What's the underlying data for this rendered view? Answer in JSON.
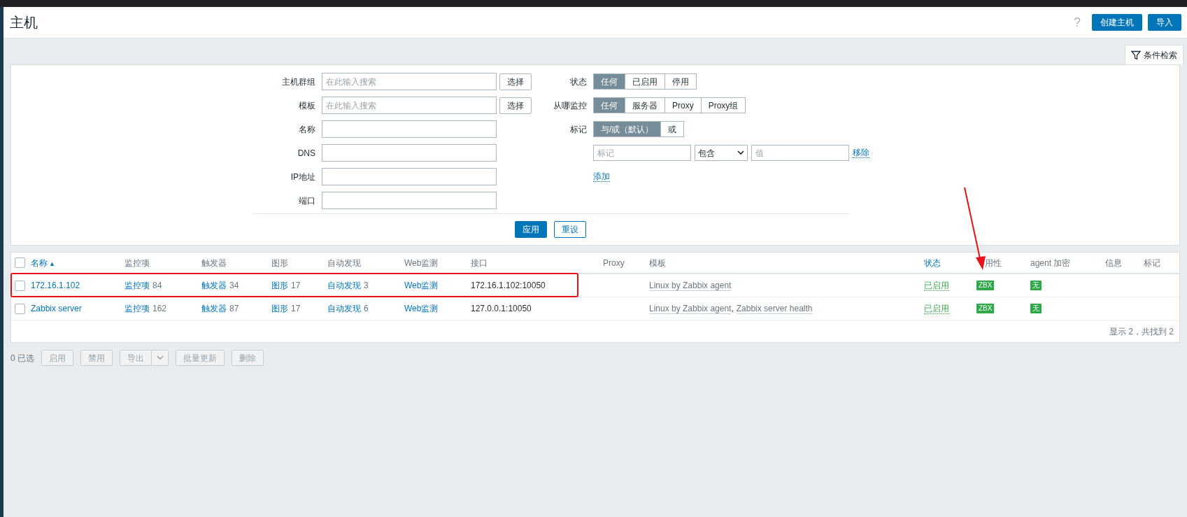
{
  "header": {
    "title": "主机",
    "help": "?",
    "buttons": [
      "创建主机",
      "导入"
    ]
  },
  "filter": {
    "tab_label": "条件检索",
    "left_fields": [
      {
        "label": "主机群组",
        "placeholder": "在此输入搜索",
        "button": "选择"
      },
      {
        "label": "模板",
        "placeholder": "在此输入搜索",
        "button": "选择"
      },
      {
        "label": "名称"
      },
      {
        "label": "DNS"
      },
      {
        "label": "IP地址"
      },
      {
        "label": "端口"
      }
    ],
    "segments": [
      {
        "label": "状态",
        "options": [
          {
            "label": "任何",
            "selected": true
          },
          {
            "label": "已启用",
            "selected": false
          },
          {
            "label": "停用",
            "selected": false
          }
        ]
      },
      {
        "label": "从哪监控",
        "options": [
          {
            "label": "任何",
            "selected": true
          },
          {
            "label": "服务器",
            "selected": false
          },
          {
            "label": "Proxy",
            "selected": false
          },
          {
            "label": "Proxy组",
            "selected": false
          }
        ]
      },
      {
        "label": "标记",
        "options": [
          {
            "label": "与/或（默认）",
            "selected": true
          },
          {
            "label": "或",
            "selected": false
          }
        ]
      }
    ],
    "tag_row": {
      "tag_placeholder": "标记",
      "operator": "包含",
      "value_placeholder": "值",
      "remove": "移除"
    },
    "add_link": "添加",
    "apply": "应用",
    "reset": "重设"
  },
  "table": {
    "select_all_checked": false,
    "template_separator": ",",
    "columns": [
      {
        "label": "名称",
        "sort": "▲",
        "link": true
      },
      {
        "label": "监控项",
        "link": false
      },
      {
        "label": "触发器",
        "link": false
      },
      {
        "label": "图形",
        "link": false
      },
      {
        "label": "自动发现",
        "link": false
      },
      {
        "label": "Web监测",
        "link": false
      },
      {
        "label": "接口",
        "link": false
      },
      {
        "label": "Proxy",
        "link": false
      },
      {
        "label": "模板",
        "link": false
      },
      {
        "label": "状态",
        "link": true
      },
      {
        "label": "用性",
        "link": false,
        "covered_start": true
      },
      {
        "label": "agent 加密",
        "link": false
      },
      {
        "label": "信息",
        "link": false
      },
      {
        "label": "标记",
        "link": false
      }
    ],
    "rows": [
      {
        "checked": false,
        "highlighted": true,
        "name": "172.16.1.102",
        "items": "监控项",
        "items_count": "84",
        "triggers": "触发器",
        "triggers_count": "34",
        "graphs": "图形",
        "graphs_count": "17",
        "discovery": "自动发现",
        "discovery_count": "3",
        "web": "Web监测",
        "interface": "172.16.1.102:10050",
        "templates": [
          "Linux by Zabbix agent"
        ],
        "status": "已启用",
        "availability": "ZBX",
        "encryption": "无"
      },
      {
        "checked": false,
        "highlighted": false,
        "name": "Zabbix server",
        "items": "监控项",
        "items_count": "162",
        "triggers": "触发器",
        "triggers_count": "87",
        "graphs": "图形",
        "graphs_count": "17",
        "discovery": "自动发现",
        "discovery_count": "6",
        "web": "Web监测",
        "interface": "127.0.0.1:10050",
        "templates": [
          "Linux by Zabbix agent",
          "Zabbix server health"
        ],
        "status": "已启用",
        "availability": "ZBX",
        "encryption": "无"
      }
    ],
    "footer": "显示 2，共找到 2"
  },
  "actions": {
    "selected_count": "0 已选",
    "buttons": [
      {
        "label": "启用",
        "kind": "plain",
        "disabled": true
      },
      {
        "label": "禁用",
        "kind": "plain",
        "disabled": true
      },
      {
        "label": "导出",
        "kind": "split",
        "disabled": true
      },
      {
        "label": "批量更新",
        "kind": "plain",
        "disabled": true
      },
      {
        "label": "删除",
        "kind": "plain",
        "disabled": true
      }
    ]
  }
}
